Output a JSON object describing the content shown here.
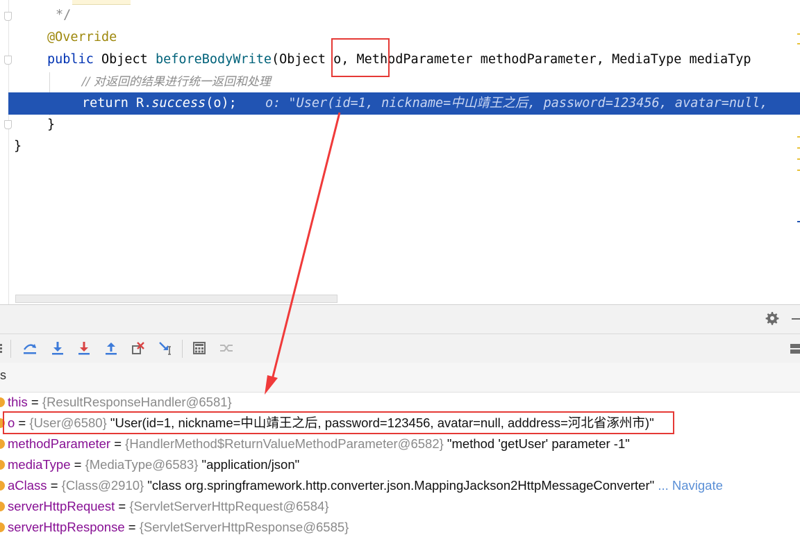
{
  "editor": {
    "code_lines": {
      "comment_end": "*/",
      "annotation": "@Override",
      "sig_kw": "public",
      "sig_type": "Object",
      "sig_method": "beforeBodyWrite",
      "sig_params": "(Object o, MethodParameter methodParameter, MediaType mediaTyp",
      "comment": "// 对返回的结果进行统一返回和处理",
      "exec_return": "return R.",
      "exec_call": "success",
      "exec_rest": "(o);",
      "exec_inline": "o: \"User(id=1, nickname=中山靖王之后, password=123456, avatar=null,",
      "close_method": "}",
      "close_class": "}"
    }
  },
  "variables": [
    {
      "name": "this",
      "eq": " = ",
      "type": "{ResultResponseHandler@6581}",
      "value": "",
      "nav": ""
    },
    {
      "name": "o",
      "eq": " = ",
      "type": "{User@6580}",
      "value": " \"User(id=1, nickname=中山靖王之后, password=123456, avatar=null, adddress=河北省涿州市)\"",
      "nav": ""
    },
    {
      "name": "methodParameter",
      "eq": " = ",
      "type": "{HandlerMethod$ReturnValueMethodParameter@6582}",
      "value": " \"method 'getUser' parameter -1\"",
      "nav": ""
    },
    {
      "name": "mediaType",
      "eq": " = ",
      "type": "{MediaType@6583}",
      "value": " \"application/json\"",
      "nav": ""
    },
    {
      "name": "aClass",
      "eq": " = ",
      "type": "{Class@2910}",
      "value": " \"class org.springframework.http.converter.json.MappingJackson2HttpMessageConverter\"",
      "nav": " ... Navigate"
    },
    {
      "name": "serverHttpRequest",
      "eq": " = ",
      "type": "{ServletServerHttpRequest@6584}",
      "value": "",
      "nav": ""
    },
    {
      "name": "serverHttpResponse",
      "eq": " = ",
      "type": "{ServletServerHttpResponse@6585}",
      "value": "",
      "nav": ""
    }
  ],
  "vars_header": {
    "label": "s"
  },
  "icons": {
    "toolbar": [
      "step-over-icon",
      "step-into-icon",
      "force-step-into-icon",
      "step-out-icon",
      "drop-frame-icon",
      "run-to-cursor-icon",
      "evaluate-expression-icon",
      "trace-stream-icon"
    ],
    "panel": [
      "gear-icon",
      "minimize-icon",
      "layout-icon"
    ]
  },
  "colors": {
    "exec_line": "#2154b3",
    "highlight_box": "#e53935",
    "var_dot": "#f0a732"
  }
}
